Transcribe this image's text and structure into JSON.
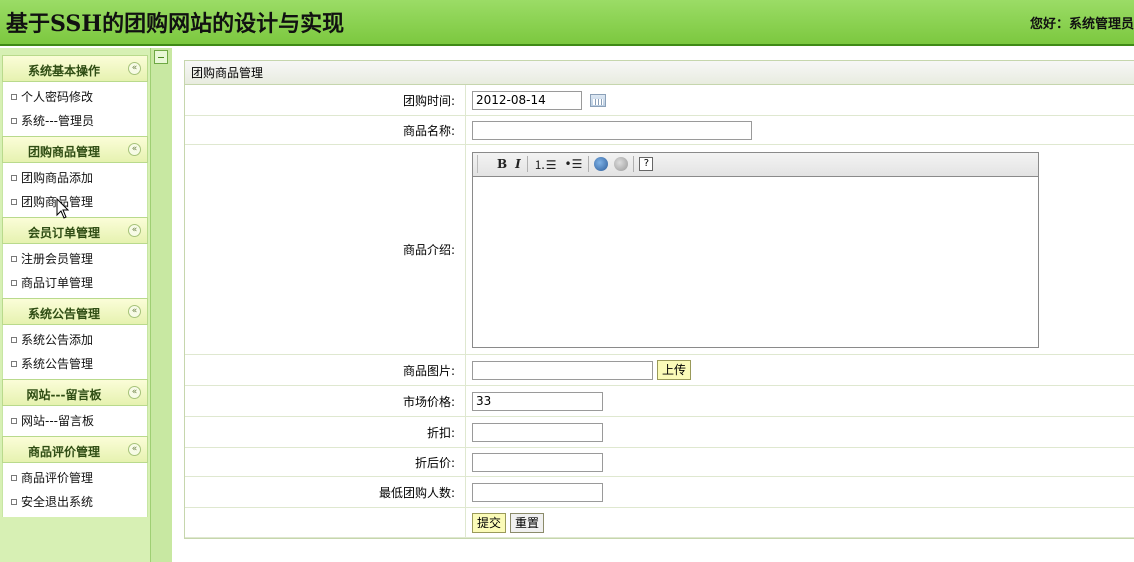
{
  "header": {
    "title": "基于SSH的团购网站的设计与实现",
    "greeting": "您好：系统管理员"
  },
  "sidebar": {
    "groups": [
      {
        "title": "系统基本操作",
        "items": [
          "个人密码修改",
          "系统---管理员"
        ]
      },
      {
        "title": "团购商品管理",
        "items": [
          "团购商品添加",
          "团购商品管理"
        ]
      },
      {
        "title": "会员订单管理",
        "items": [
          "注册会员管理",
          "商品订单管理"
        ]
      },
      {
        "title": "系统公告管理",
        "items": [
          "系统公告添加",
          "系统公告管理"
        ]
      },
      {
        "title": "网站---留言板",
        "items": [
          "网站---留言板"
        ]
      },
      {
        "title": "商品评价管理",
        "items": [
          "商品评价管理",
          "安全退出系统"
        ]
      }
    ],
    "collapse_glyph": "«"
  },
  "panel": {
    "title": "团购商品管理",
    "fields": {
      "date_label": "团购时间:",
      "date_value": "2012-08-14",
      "name_label": "商品名称:",
      "name_value": "",
      "desc_label": "商品介绍:",
      "image_label": "商品图片:",
      "image_value": "",
      "upload_label": "上传",
      "price_label": "市场价格:",
      "price_value": "33",
      "discount_label": "折扣:",
      "discount_value": "",
      "after_label": "折后价:",
      "after_value": "",
      "min_label": "最低团购人数:",
      "min_value": ""
    },
    "editor_toolbar": {
      "bold": "B",
      "italic": "I",
      "ordered_list": "⒈☰",
      "unordered_list": "•☰",
      "help": "?"
    },
    "submit_label": "提交",
    "reset_label": "重置"
  }
}
